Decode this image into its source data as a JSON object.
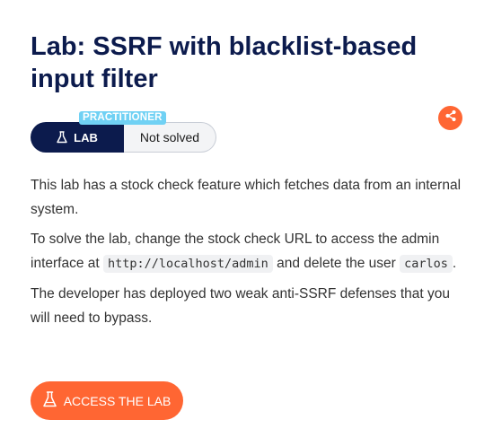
{
  "lab": {
    "title": "Lab: SSRF with blacklist-based input filter",
    "level_badge": "PRACTITIONER",
    "lab_label": "LAB",
    "status": "Not solved"
  },
  "description": {
    "p1": "This lab has a stock check feature which fetches data from an internal system.",
    "p2_before": "To solve the lab, change the stock check URL to access the admin interface at ",
    "p2_code1": "http://localhost/admin",
    "p2_middle": " and delete the user ",
    "p2_code2": "carlos",
    "p2_after": ".",
    "p3": "The developer has deployed two weak anti-SSRF defenses that you will need to bypass."
  },
  "actions": {
    "access_label": "ACCESS THE LAB"
  },
  "icons": {
    "flask": "flask-icon",
    "share": "share-icon"
  },
  "colors": {
    "title": "#0c1b4d",
    "lab_pill": "#0c1b4d",
    "badge": "#70d1f4",
    "accent": "#ff6633"
  }
}
